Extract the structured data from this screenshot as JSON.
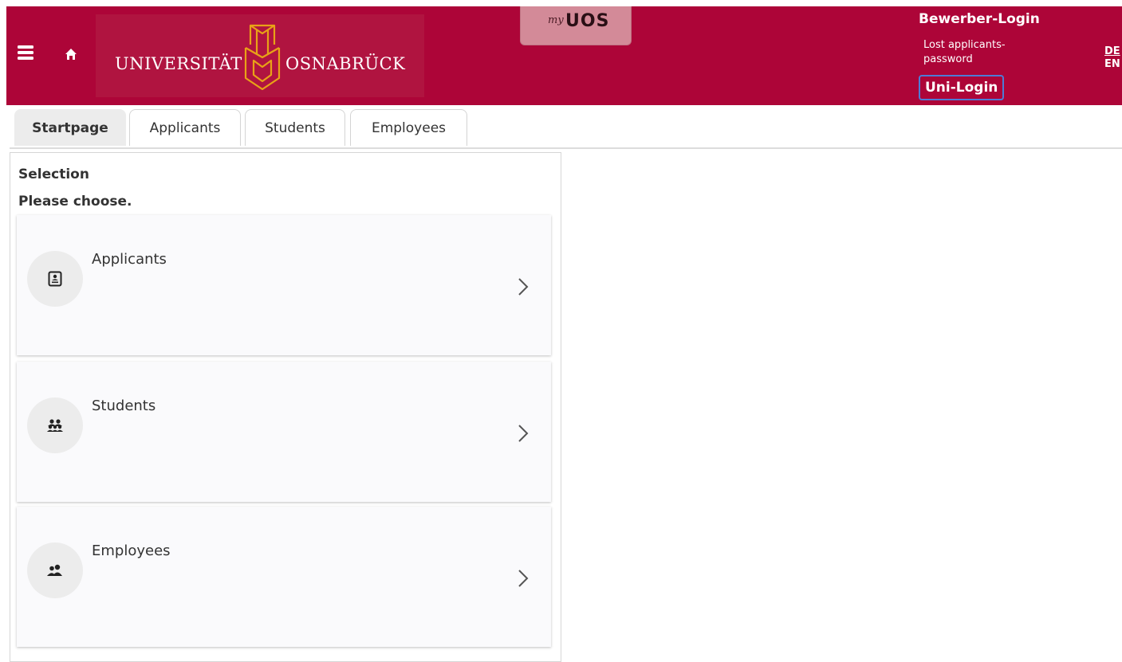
{
  "header": {
    "logo_left": "UNIVERSITÄT",
    "logo_right": "OSNABRÜCK",
    "myuos_prefix": "my",
    "myuos_name": "UOS",
    "bewerber_login": "Bewerber-Login",
    "lost_password": "Lost applicants-password",
    "lang_de": "DE",
    "lang_sep": "|",
    "lang_en": "EN",
    "uni_login": "Uni-Login",
    "colors": {
      "brand": "#ad0538",
      "logo_emblem": "#e8a217",
      "focus_ring": "#4d7bd6"
    }
  },
  "tabs": [
    {
      "label": "Startpage",
      "active": true
    },
    {
      "label": "Applicants",
      "active": false
    },
    {
      "label": "Students",
      "active": false
    },
    {
      "label": "Employees",
      "active": false
    }
  ],
  "selection": {
    "title": "Selection",
    "subtitle": "Please choose.",
    "cards": [
      {
        "label": "Applicants",
        "icon": "applicant-document-icon"
      },
      {
        "label": "Students",
        "icon": "students-group-icon"
      },
      {
        "label": "Employees",
        "icon": "employees-group-icon"
      }
    ]
  }
}
